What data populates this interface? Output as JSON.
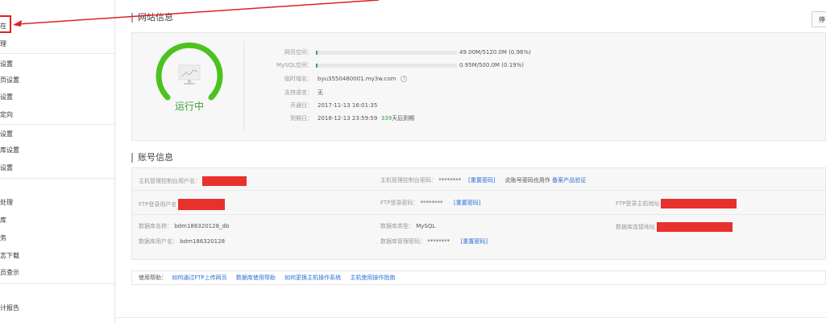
{
  "sidebar": {
    "items": [
      {
        "label": "在"
      },
      {
        "label": "理"
      },
      {
        "label": "设置"
      },
      {
        "label": "页设置"
      },
      {
        "label": "设置"
      },
      {
        "label": "定向"
      },
      {
        "label": "设置"
      },
      {
        "label": "库设置"
      },
      {
        "label": "设置"
      },
      {
        "label": "处理"
      },
      {
        "label": "库"
      },
      {
        "label": "务"
      },
      {
        "label": "志下载"
      },
      {
        "label": "员查示"
      },
      {
        "label": "计报告"
      }
    ]
  },
  "site_info": {
    "title": "网站信息",
    "stop_button": "停",
    "status": "运行中",
    "rows": [
      {
        "label": "网页空间：",
        "usage": "49.00M/5120.0M (0.96%)",
        "percent": 0.96
      },
      {
        "label": "MySQL空间：",
        "usage": "0.95M/500.0M (0.19%)",
        "percent": 0.19
      },
      {
        "label": "临时域名：",
        "value": "byu3550480001.my3w.com"
      },
      {
        "label": "支持语言：",
        "value": "无"
      },
      {
        "label": "开通日：",
        "value": "2017-11-13 16:01:35"
      },
      {
        "label": "到期日：",
        "value": "2018-12-13 23:59:59",
        "days": "339",
        "days_suffix": "天后到期"
      }
    ]
  },
  "account_info": {
    "title": "账号信息",
    "host_user_label": "主机管理控制台用户名：",
    "host_pwd_label": "主机管理控制台密码：",
    "host_pwd_value": "********",
    "reset_pwd": "[重置密码]",
    "also_use_text": "此账号密码也用作",
    "also_use_link": "备案产品验证",
    "ftp_user_label": "FTP登录用户名",
    "ftp_pwd_label": "FTP登录密码：",
    "ftp_pwd_value": "********",
    "ftp_host_label": "FTP登录主机地址",
    "db_name_label": "数据库名称：",
    "db_name_value": "bdm186320128_db",
    "db_type_label": "数据库类型：",
    "db_type_value": "MySQL",
    "db_host_label": "数据库连接地址",
    "db_user_label": "数据库用户名：",
    "db_user_value": "bdm186320128",
    "db_pwd_label": "数据库管理密码：",
    "db_pwd_value": "********"
  },
  "help": {
    "label": "使用帮助：",
    "links": [
      "如何通过FTP上传网页",
      "数据库使用帮助",
      "如何更换主机操作系统",
      "主机使用操作指南"
    ]
  },
  "colors": {
    "accent_green": "#43a047",
    "link_blue": "#2a6fd6",
    "redaction_red": "#e8302d",
    "annotation_red": "#e02020"
  }
}
